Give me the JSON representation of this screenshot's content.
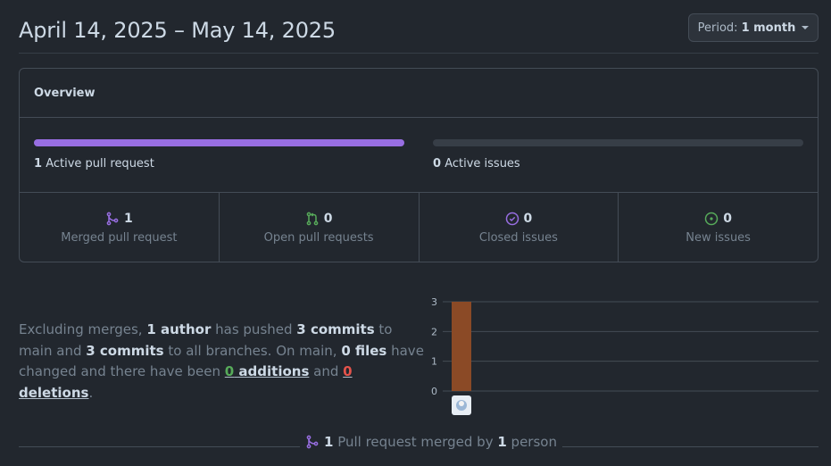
{
  "header": {
    "date_range": "April 14, 2025 – May 14, 2025",
    "period_prefix": "Period:",
    "period_value": "1 month"
  },
  "overview": {
    "title": "Overview",
    "pull_requests": {
      "count": "1",
      "label": "Active pull request",
      "fill_fraction": 1.0
    },
    "issues": {
      "count": "0",
      "label": "Active issues",
      "fill_fraction": 0.0
    },
    "stats": [
      {
        "icon": "merged-pull-request-icon",
        "count": "1",
        "label": "Merged pull request",
        "color": "#986ee2"
      },
      {
        "icon": "open-pull-request-icon",
        "count": "0",
        "label": "Open pull requests",
        "color": "#57ab5a"
      },
      {
        "icon": "closed-issue-icon",
        "count": "0",
        "label": "Closed issues",
        "color": "#986ee2"
      },
      {
        "icon": "new-issue-icon",
        "count": "0",
        "label": "New issues",
        "color": "#57ab5a"
      }
    ]
  },
  "summary": {
    "t1": "Excluding merges, ",
    "authors": "1 author",
    "t2": " has pushed ",
    "commits_main": "3 commits",
    "t3": " to main and ",
    "commits_all": "3 commits",
    "t4": " to all branches. On main, ",
    "files": "0 files",
    "t5": " have changed and there have been ",
    "additions_count": "0",
    "additions_word": " additions",
    "t6": " and ",
    "deletions_count": "0",
    "deletions_word": " deletions",
    "t7": "."
  },
  "chart_data": {
    "type": "bar",
    "categories": [
      "author-avatar"
    ],
    "values": [
      3
    ],
    "ylim": [
      0,
      3
    ],
    "yticks": [
      "0",
      "1",
      "2",
      "3"
    ],
    "bar_color": "#8b4a26",
    "grid": true
  },
  "footer": {
    "count": "1",
    "text1": " Pull request merged by ",
    "people": "1",
    "text2": " person"
  },
  "colors": {
    "accent_purple": "#986ee2",
    "accent_green": "#57ab5a",
    "deletion_red": "#e5534b"
  }
}
